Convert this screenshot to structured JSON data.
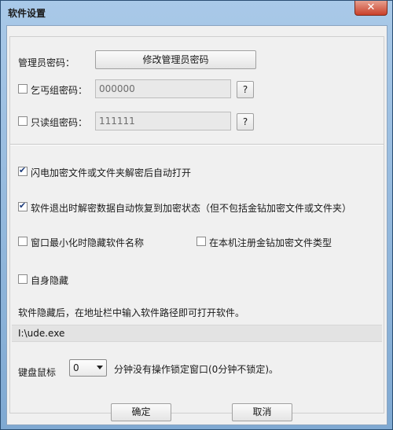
{
  "window": {
    "title": "软件设置",
    "close_glyph": "✕"
  },
  "admin": {
    "label": "管理员密码：",
    "button": "修改管理员密码"
  },
  "beggar": {
    "label": "乞丐组密码：",
    "value": "000000",
    "help": "?"
  },
  "readonly": {
    "label": "只读组密码：",
    "value": "111111",
    "help": "?"
  },
  "options": {
    "flash_open": {
      "label": "闪电加密文件或文件夹解密后自动打开",
      "checked": true
    },
    "restore_on_exit": {
      "label": "软件退出时解密数据自动恢复到加密状态（但不包括金钻加密文件或文件夹）",
      "checked": true
    },
    "hide_name_on_minimize": {
      "label": "窗口最小化时隐藏软件名称",
      "checked": false
    },
    "register_file_type": {
      "label": "在本机注册金钻加密文件类型",
      "checked": false
    },
    "self_hide": {
      "label": "自身隐藏",
      "checked": false
    }
  },
  "hide_note": "软件隐藏后，在地址栏中输入软件路径即可打开软件。",
  "software_path": "I:\\ude.exe",
  "lock": {
    "label": "键盘鼠标",
    "value": "0",
    "suffix": "分钟没有操作锁定窗口(0分钟不锁定)。"
  },
  "footer": {
    "ok": "确定",
    "cancel": "取消"
  }
}
